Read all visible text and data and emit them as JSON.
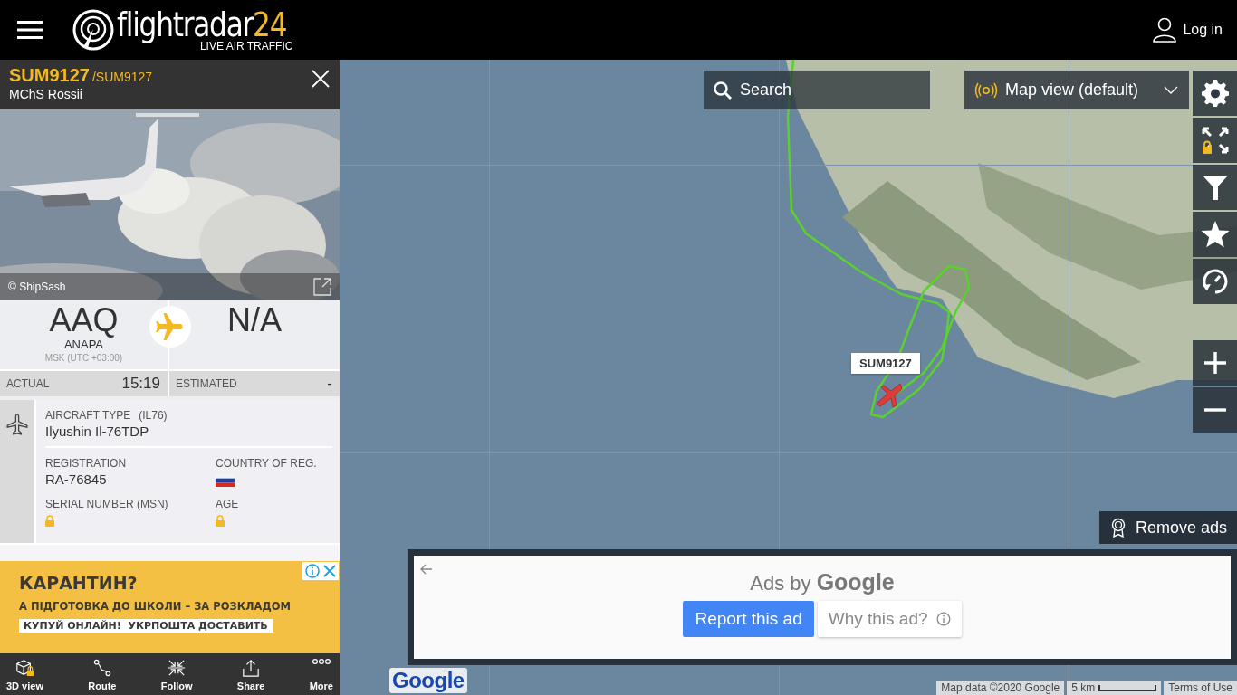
{
  "header": {
    "logo": {
      "name": "flightradar",
      "suffix": "24",
      "tagline": "LIVE AIR TRAFFIC"
    },
    "login": "Log in"
  },
  "flight": {
    "callsign": "SUM9127",
    "alt_callsign": "/SUM9127",
    "operator": "MChS Rossii",
    "photo": {
      "kind": "picture",
      "credit": "© ShipSash"
    },
    "origin": {
      "code": "AAQ",
      "city": "ANAPA",
      "timezone": "MSK (UTC +03:00)"
    },
    "destination": {
      "code": "N/A"
    },
    "times": [
      {
        "label": "ACTUAL",
        "value": "15:19"
      },
      {
        "label": "ESTIMATED",
        "value": "-"
      }
    ],
    "aircraft": {
      "type_label": "AIRCRAFT TYPE",
      "type_code": "(IL76)",
      "type": "Ilyushin Il-76TDP",
      "fields": [
        {
          "label": "REGISTRATION",
          "kind": "text",
          "value": "RA-76845"
        },
        {
          "label": "COUNTRY OF REG.",
          "kind": "flag"
        },
        {
          "label": "SERIAL NUMBER (MSN)",
          "kind": "locked"
        },
        {
          "label": "AGE",
          "kind": "locked"
        }
      ]
    }
  },
  "ad_banner": {
    "headline": "КАРАНТИН?",
    "line": "А ПІДГОТОВКА ДО ШКОЛИ – ЗА РОЗКЛАДОМ",
    "cta": "КУПУЙ ОНЛАЙН!  УКРПОШТА ДОСТАВИТЬ"
  },
  "toolbar": [
    {
      "label": "3D view",
      "kind": "cube"
    },
    {
      "label": "Route",
      "kind": "route"
    },
    {
      "label": "Follow",
      "kind": "follow"
    },
    {
      "label": "Share",
      "kind": "share"
    },
    {
      "label": "More",
      "kind": "more"
    }
  ],
  "map": {
    "search": "Search",
    "view_menu": "Map view (default)",
    "tools": [
      {
        "kind": "settings"
      },
      {
        "kind": "fullscreen"
      },
      {
        "kind": "filter"
      },
      {
        "kind": "favorites"
      },
      {
        "kind": "playback"
      }
    ],
    "zoom": [
      {
        "kind": "in"
      },
      {
        "kind": "out"
      }
    ],
    "aircraft_label": "SUM9127",
    "remove_ads": "Remove ads",
    "ad": {
      "ads_by": "Ads by",
      "brand": "Google",
      "report": "Report this ad",
      "why": "Why this ad?"
    },
    "google_logo": "Google",
    "attribution": [
      "Map data ©2020 Google",
      "5 km",
      "Terms of Use"
    ]
  }
}
